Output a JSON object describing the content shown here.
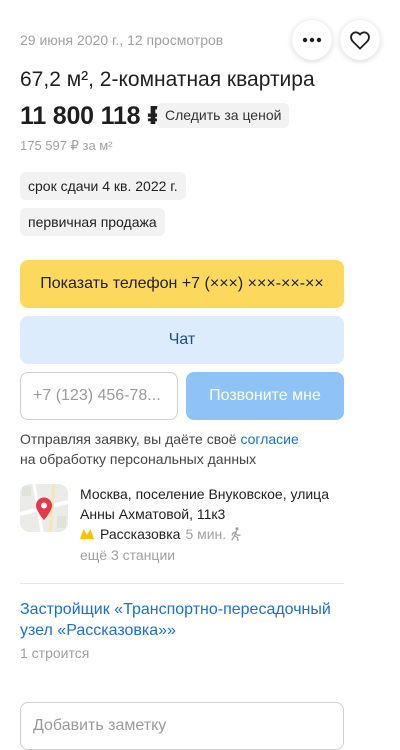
{
  "listing": {
    "meta": "29 июня 2020 г., 12 просмотров",
    "title": "67,2 м², 2-комнатная квартира",
    "price": "11 800 118 ₽",
    "watch_price_label": "Следить за ценой",
    "price_per_m2": "175 597 ₽ за м²"
  },
  "tags": [
    "срок сдачи 4 кв. 2022 г.",
    "первичная продажа"
  ],
  "actions": {
    "show_phone_label": "Показать телефон +7 (×××) ×××-××-××",
    "chat_label": "Чат",
    "phone_placeholder": "+7 (123) 456-78...",
    "call_me_label": "Позвоните мне"
  },
  "consent": {
    "prefix": "Отправляя заявку, вы даёте своё ",
    "link": "согласие",
    "suffix": "на обработку персональных данных"
  },
  "location": {
    "address": "Москва, поселение Внуковское, улица Анны Ахматовой, 11к3",
    "metro_station": "Рассказовка",
    "metro_distance": "5 мин.",
    "more_stations": "ещё 3 станции"
  },
  "developer": {
    "name": "Застройщик «Транспортно-пересадочный узел «Рассказовка»»",
    "building_count": "1 строится"
  },
  "note": {
    "placeholder": "Добавить заметку"
  },
  "icons": {
    "more": "more-icon",
    "favorite": "heart-icon",
    "map_pin": "map-pin-icon",
    "metro": "metro-icon",
    "walk": "walk-icon"
  },
  "colors": {
    "phone_button": "#fcd85c",
    "chat_button": "#dcecfc",
    "call_button": "#8fc3f7",
    "link": "#1a6fd1",
    "metro_line": "#fcc200",
    "pin": "#e8364a"
  }
}
